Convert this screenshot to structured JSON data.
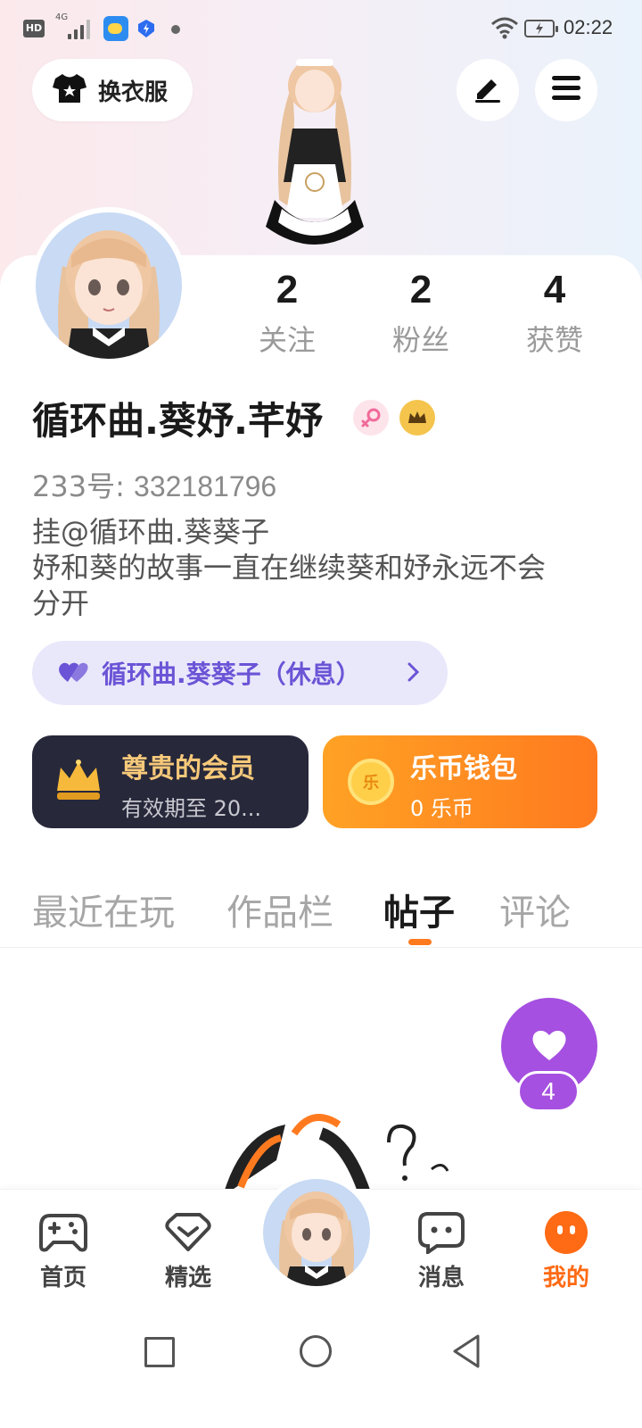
{
  "status_bar": {
    "hd": "HD",
    "network": "4G",
    "time": "02:22"
  },
  "header": {
    "dress_up_label": "换衣服",
    "edit_icon": "pencil-icon",
    "menu_icon": "menu-icon"
  },
  "stats": [
    {
      "value": "2",
      "label": "关注"
    },
    {
      "value": "2",
      "label": "粉丝"
    },
    {
      "value": "4",
      "label": "获赞"
    }
  ],
  "profile": {
    "username": "循环曲.葵妤.芊妤",
    "uid_label": "233号:",
    "uid_value": "332181796",
    "bio_lines": [
      "挂@循环曲.葵葵子",
      "妤和葵的故事一直在继续葵和妤永远不会",
      "分开"
    ],
    "cp_tag": "循环曲.葵葵子（休息）"
  },
  "vip": {
    "title": "尊贵的会员",
    "subtitle": "有效期至 20..."
  },
  "wallet": {
    "title": "乐币钱包",
    "subtitle": "0 乐币",
    "coin_text": "乐"
  },
  "tabs": [
    {
      "label": "最近在玩",
      "active": false
    },
    {
      "label": "作品栏",
      "active": false
    },
    {
      "label": "帖子",
      "active": true
    },
    {
      "label": "评论",
      "active": false
    }
  ],
  "like_fab": {
    "count": "4"
  },
  "bottom_nav": [
    {
      "label": "首页",
      "icon": "gamepad-icon",
      "active": false
    },
    {
      "label": "精选",
      "icon": "heart-diamond-icon",
      "active": false
    },
    {
      "label": "消息",
      "icon": "chat-icon",
      "active": false
    },
    {
      "label": "我的",
      "icon": "face-icon",
      "active": true
    }
  ],
  "colors": {
    "accent_orange": "#ff7a1f",
    "purple": "#a550e0",
    "vip_dark": "#27283a",
    "vip_gold": "#f7c97a"
  }
}
